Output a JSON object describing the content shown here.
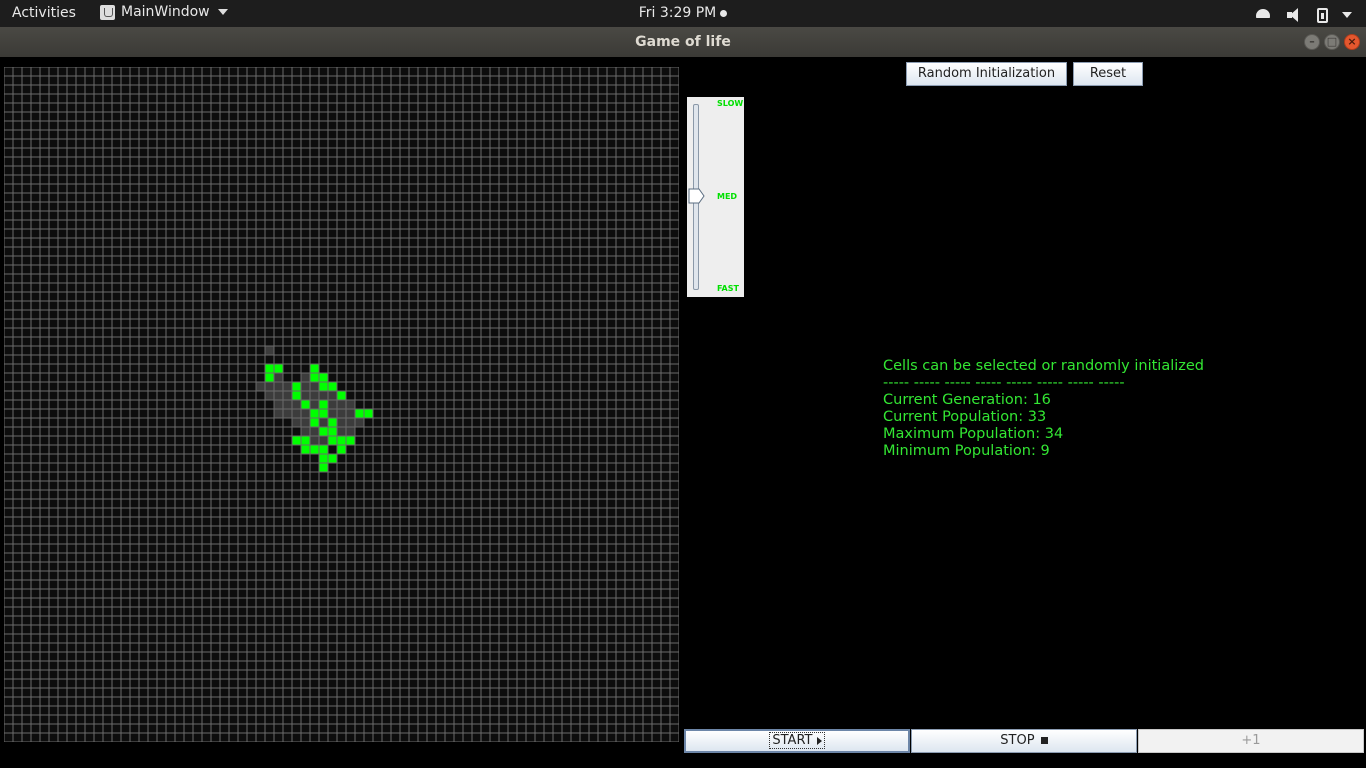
{
  "topbar": {
    "activities": "Activities",
    "app_name": "MainWindow",
    "clock": "Fri  3:29 PM",
    "icons": [
      "wifi-icon",
      "volume-muted-icon",
      "battery-icon",
      "system-menu-caret"
    ]
  },
  "window": {
    "title": "Game of life",
    "controls": [
      "minimize",
      "maximize",
      "close"
    ]
  },
  "board": {
    "rows": 75,
    "cols": 75,
    "colors": {
      "background": "#0d0d0d",
      "grid": "#6b6b6b",
      "alive": "#00ff00",
      "dead_visited": "#3c3c3c"
    },
    "alive_cells": [
      [
        33,
        29
      ],
      [
        33,
        30
      ],
      [
        34,
        29
      ],
      [
        33,
        34
      ],
      [
        34,
        34
      ],
      [
        34,
        35
      ],
      [
        35,
        32
      ],
      [
        35,
        35
      ],
      [
        35,
        36
      ],
      [
        36,
        32
      ],
      [
        36,
        37
      ],
      [
        37,
        33
      ],
      [
        37,
        35
      ],
      [
        38,
        34
      ],
      [
        38,
        35
      ],
      [
        38,
        39
      ],
      [
        38,
        40
      ],
      [
        39,
        34
      ],
      [
        39,
        36
      ],
      [
        40,
        35
      ],
      [
        40,
        36
      ],
      [
        41,
        32
      ],
      [
        41,
        33
      ],
      [
        41,
        36
      ],
      [
        41,
        37
      ],
      [
        41,
        38
      ],
      [
        42,
        33
      ],
      [
        42,
        34
      ],
      [
        42,
        35
      ],
      [
        42,
        37
      ],
      [
        43,
        35
      ],
      [
        43,
        36
      ],
      [
        44,
        35
      ]
    ],
    "visited_cells": [
      [
        31,
        29
      ],
      [
        34,
        30
      ],
      [
        34,
        33
      ],
      [
        35,
        28
      ],
      [
        35,
        29
      ],
      [
        35,
        30
      ],
      [
        35,
        31
      ],
      [
        35,
        33
      ],
      [
        35,
        34
      ],
      [
        36,
        29
      ],
      [
        36,
        30
      ],
      [
        36,
        31
      ],
      [
        36,
        33
      ],
      [
        36,
        34
      ],
      [
        36,
        35
      ],
      [
        36,
        36
      ],
      [
        37,
        30
      ],
      [
        37,
        31
      ],
      [
        37,
        32
      ],
      [
        37,
        34
      ],
      [
        37,
        36
      ],
      [
        37,
        37
      ],
      [
        37,
        38
      ],
      [
        38,
        30
      ],
      [
        38,
        31
      ],
      [
        38,
        32
      ],
      [
        38,
        33
      ],
      [
        38,
        36
      ],
      [
        38,
        37
      ],
      [
        38,
        38
      ],
      [
        39,
        32
      ],
      [
        39,
        33
      ],
      [
        39,
        35
      ],
      [
        39,
        37
      ],
      [
        39,
        38
      ],
      [
        39,
        39
      ],
      [
        40,
        33
      ],
      [
        40,
        34
      ],
      [
        40,
        37
      ],
      [
        40,
        38
      ],
      [
        41,
        34
      ],
      [
        41,
        35
      ]
    ]
  },
  "controls": {
    "random_init": "Random Initialization",
    "reset": "Reset",
    "start": "START",
    "stop": "STOP",
    "step": "+1"
  },
  "speed_slider": {
    "labels": {
      "slow": "SLOW",
      "med": "MED",
      "fast": "FAST"
    },
    "value_fraction_from_top": 0.5
  },
  "info": {
    "heading": "Cells can be selected or randomly initialized",
    "separator": "----- ----- ----- ----- ----- ----- ----- -----",
    "generation": "Current Generation: 16",
    "population": "Current Population: 33",
    "max_population": "Maximum Population: 34",
    "min_population": "Minimum Population: 9"
  },
  "colors": {
    "text_green": "#33e633",
    "slider_label_green": "#00e000"
  }
}
